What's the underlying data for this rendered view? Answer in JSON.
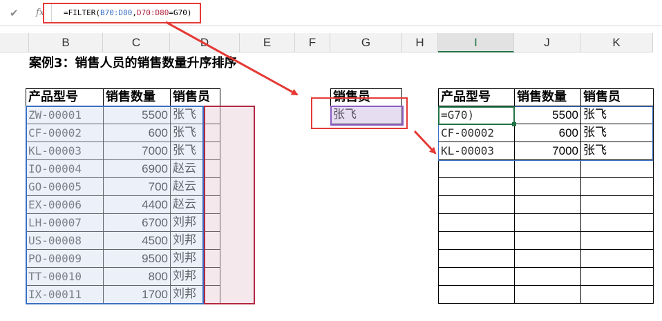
{
  "formula_bar": {
    "cancel_icon": "check-icon",
    "fx_label": "fx",
    "formula_prefix": "=FILTER(",
    "formula_range1": "B70:D80",
    "formula_sep": ",",
    "formula_range2": "D70:D80",
    "formula_suffix": "=G70)"
  },
  "columns": [
    {
      "label": "B",
      "selected": false
    },
    {
      "label": "C",
      "selected": false
    },
    {
      "label": "D",
      "selected": false
    },
    {
      "label": "E",
      "selected": false
    },
    {
      "label": "F",
      "selected": false
    },
    {
      "label": "G",
      "selected": false
    },
    {
      "label": "H",
      "selected": false
    },
    {
      "label": "I",
      "selected": true
    },
    {
      "label": "J",
      "selected": false
    },
    {
      "label": "K",
      "selected": false
    }
  ],
  "title": "案例3：销售人员的销售数量升序排序",
  "source_table": {
    "headers": [
      "产品型号",
      "销售数量",
      "销售员"
    ],
    "rows": [
      [
        "ZW-00001",
        "5500",
        "张飞"
      ],
      [
        "CF-00002",
        "600",
        "张飞"
      ],
      [
        "KL-00003",
        "7000",
        "张飞"
      ],
      [
        "IO-00004",
        "6900",
        "赵云"
      ],
      [
        "GO-00005",
        "700",
        "赵云"
      ],
      [
        "EX-00006",
        "4400",
        "赵云"
      ],
      [
        "LH-00007",
        "6700",
        "刘邦"
      ],
      [
        "US-00008",
        "4500",
        "刘邦"
      ],
      [
        "PO-00009",
        "9500",
        "刘邦"
      ],
      [
        "TT-00010",
        "800",
        "刘邦"
      ],
      [
        "IX-00011",
        "1700",
        "刘邦"
      ]
    ]
  },
  "criteria": {
    "header": "销售员",
    "value": "张飞"
  },
  "result_table": {
    "headers": [
      "产品型号",
      "销售数量",
      "销售员"
    ],
    "rows": [
      [
        "=G70)",
        "5500",
        "张飞"
      ],
      [
        "CF-00002",
        "600",
        "张飞"
      ],
      [
        "KL-00003",
        "7000",
        "张飞"
      ],
      [
        "",
        "",
        ""
      ],
      [
        "",
        "",
        ""
      ],
      [
        "",
        "",
        ""
      ],
      [
        "",
        "",
        ""
      ],
      [
        "",
        "",
        ""
      ],
      [
        "",
        "",
        ""
      ],
      [
        "",
        "",
        ""
      ],
      [
        "",
        "",
        ""
      ]
    ]
  },
  "colors": {
    "annotation_red": "#e53935",
    "range_blue": "#3a6fc4",
    "range_red": "#b3263f",
    "criteria_purple": "#8e5bc2",
    "selected_green": "#217346"
  }
}
